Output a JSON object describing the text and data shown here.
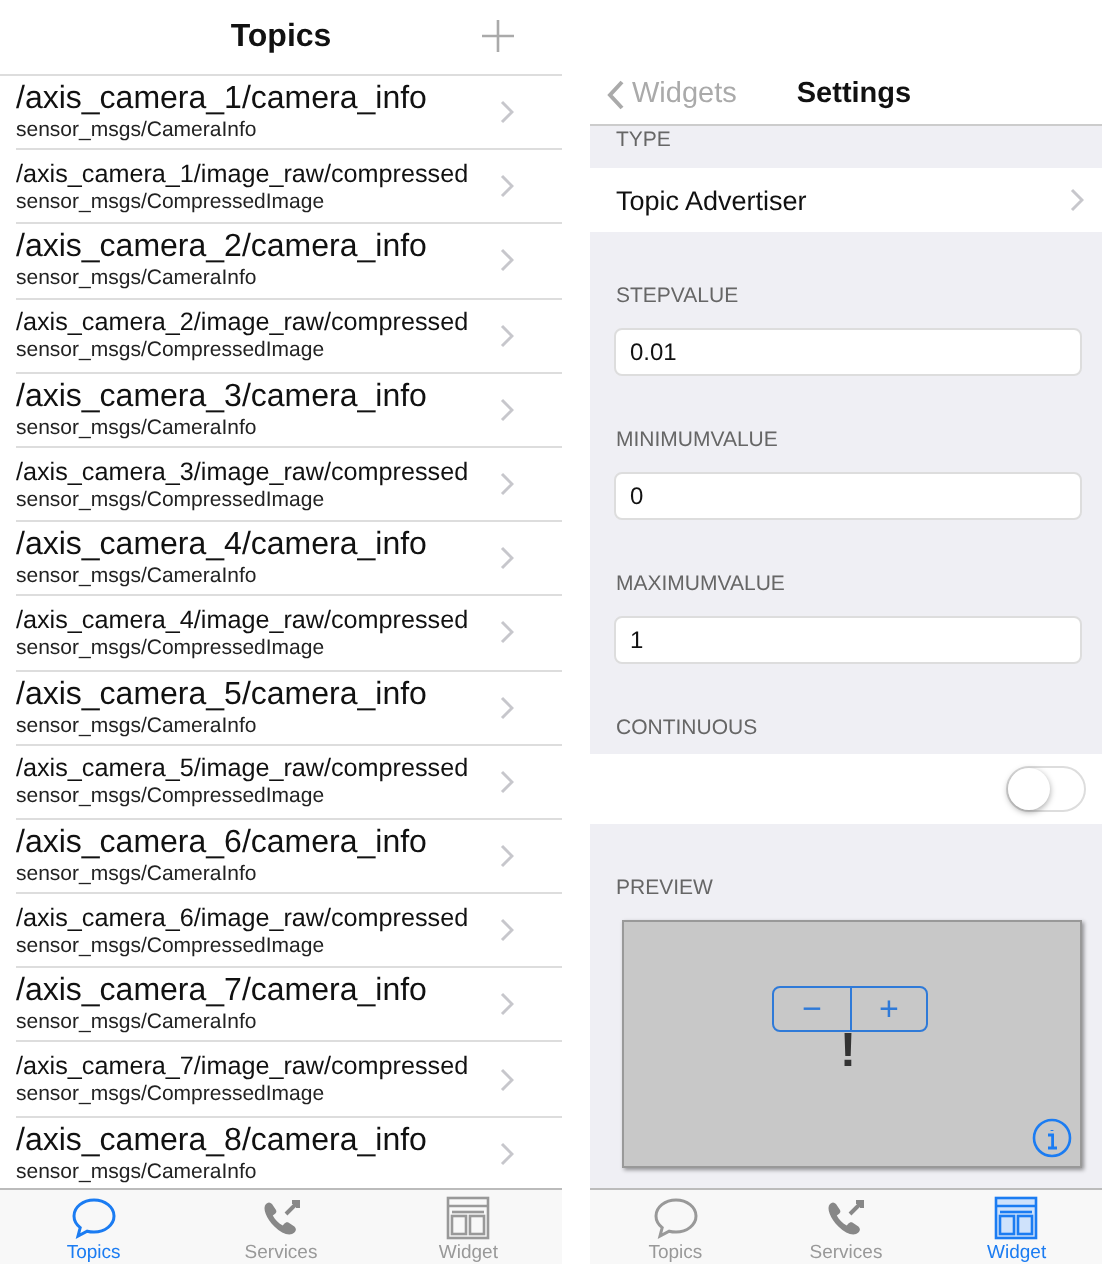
{
  "topics_screen": {
    "title": "Topics",
    "topics": [
      {
        "kind": "info",
        "name": "/axis_camera_1/camera_info",
        "type": "sensor_msgs/CameraInfo"
      },
      {
        "kind": "image",
        "name": "/axis_camera_1/image_raw/compressed",
        "type": "sensor_msgs/CompressedImage"
      },
      {
        "kind": "info",
        "name": "/axis_camera_2/camera_info",
        "type": "sensor_msgs/CameraInfo"
      },
      {
        "kind": "image",
        "name": "/axis_camera_2/image_raw/compressed",
        "type": "sensor_msgs/CompressedImage"
      },
      {
        "kind": "info",
        "name": "/axis_camera_3/camera_info",
        "type": "sensor_msgs/CameraInfo"
      },
      {
        "kind": "image",
        "name": "/axis_camera_3/image_raw/compressed",
        "type": "sensor_msgs/CompressedImage"
      },
      {
        "kind": "info",
        "name": "/axis_camera_4/camera_info",
        "type": "sensor_msgs/CameraInfo"
      },
      {
        "kind": "image",
        "name": "/axis_camera_4/image_raw/compressed",
        "type": "sensor_msgs/CompressedImage"
      },
      {
        "kind": "info",
        "name": "/axis_camera_5/camera_info",
        "type": "sensor_msgs/CameraInfo"
      },
      {
        "kind": "image",
        "name": "/axis_camera_5/image_raw/compressed",
        "type": "sensor_msgs/CompressedImage"
      },
      {
        "kind": "info",
        "name": "/axis_camera_6/camera_info",
        "type": "sensor_msgs/CameraInfo"
      },
      {
        "kind": "image",
        "name": "/axis_camera_6/image_raw/compressed",
        "type": "sensor_msgs/CompressedImage"
      },
      {
        "kind": "info",
        "name": "/axis_camera_7/camera_info",
        "type": "sensor_msgs/CameraInfo"
      },
      {
        "kind": "image",
        "name": "/axis_camera_7/image_raw/compressed",
        "type": "sensor_msgs/CompressedImage"
      },
      {
        "kind": "info",
        "name": "/axis_camera_8/camera_info",
        "type": "sensor_msgs/CameraInfo"
      }
    ],
    "tabs": [
      {
        "kind": "topics",
        "label": "Topics",
        "selected": true
      },
      {
        "kind": "services",
        "label": "Services",
        "selected": false
      },
      {
        "kind": "widget",
        "label": "Widget",
        "selected": false
      }
    ]
  },
  "settings_screen": {
    "back": "Widgets",
    "title": "Settings",
    "type_label": "TYPE",
    "type_value": "Topic Advertiser",
    "fields": [
      {
        "label": "STEPVALUE",
        "value": "0.01"
      },
      {
        "label": "MINIMUMVALUE",
        "value": "0"
      },
      {
        "label": "MAXIMUMVALUE",
        "value": "1"
      }
    ],
    "continuous_label": "CONTINUOUS",
    "continuous_on": false,
    "preview_label": "PREVIEW",
    "preview": {
      "minus": "−",
      "plus": "+",
      "indicator": "!"
    },
    "tabs": [
      {
        "kind": "topics",
        "label": "Topics",
        "selected": false
      },
      {
        "kind": "services",
        "label": "Services",
        "selected": false
      },
      {
        "kind": "widget",
        "label": "Widget",
        "selected": true
      }
    ]
  }
}
